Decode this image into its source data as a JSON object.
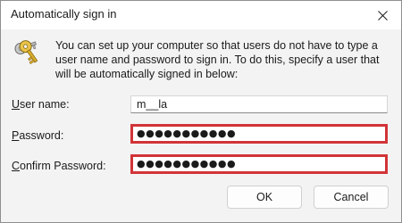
{
  "window": {
    "title": "Automatically sign in",
    "close_icon": "close-icon"
  },
  "message": {
    "icon": "keys-icon",
    "text": "You can set up your computer so that users do not have to type a user name and password to sign in. To do this, specify a user that will be automatically signed in below:"
  },
  "form": {
    "username": {
      "label_access": "U",
      "label_rest": "ser name:",
      "value": "m__la"
    },
    "password": {
      "label_access": "P",
      "label_rest": "assword:",
      "value": "●●●●●●●●●●●"
    },
    "confirm": {
      "label_access": "C",
      "label_rest": "onfirm Password:",
      "value": "●●●●●●●●●●●"
    },
    "highlight_color": "#d13438"
  },
  "buttons": {
    "ok": "OK",
    "cancel": "Cancel"
  }
}
